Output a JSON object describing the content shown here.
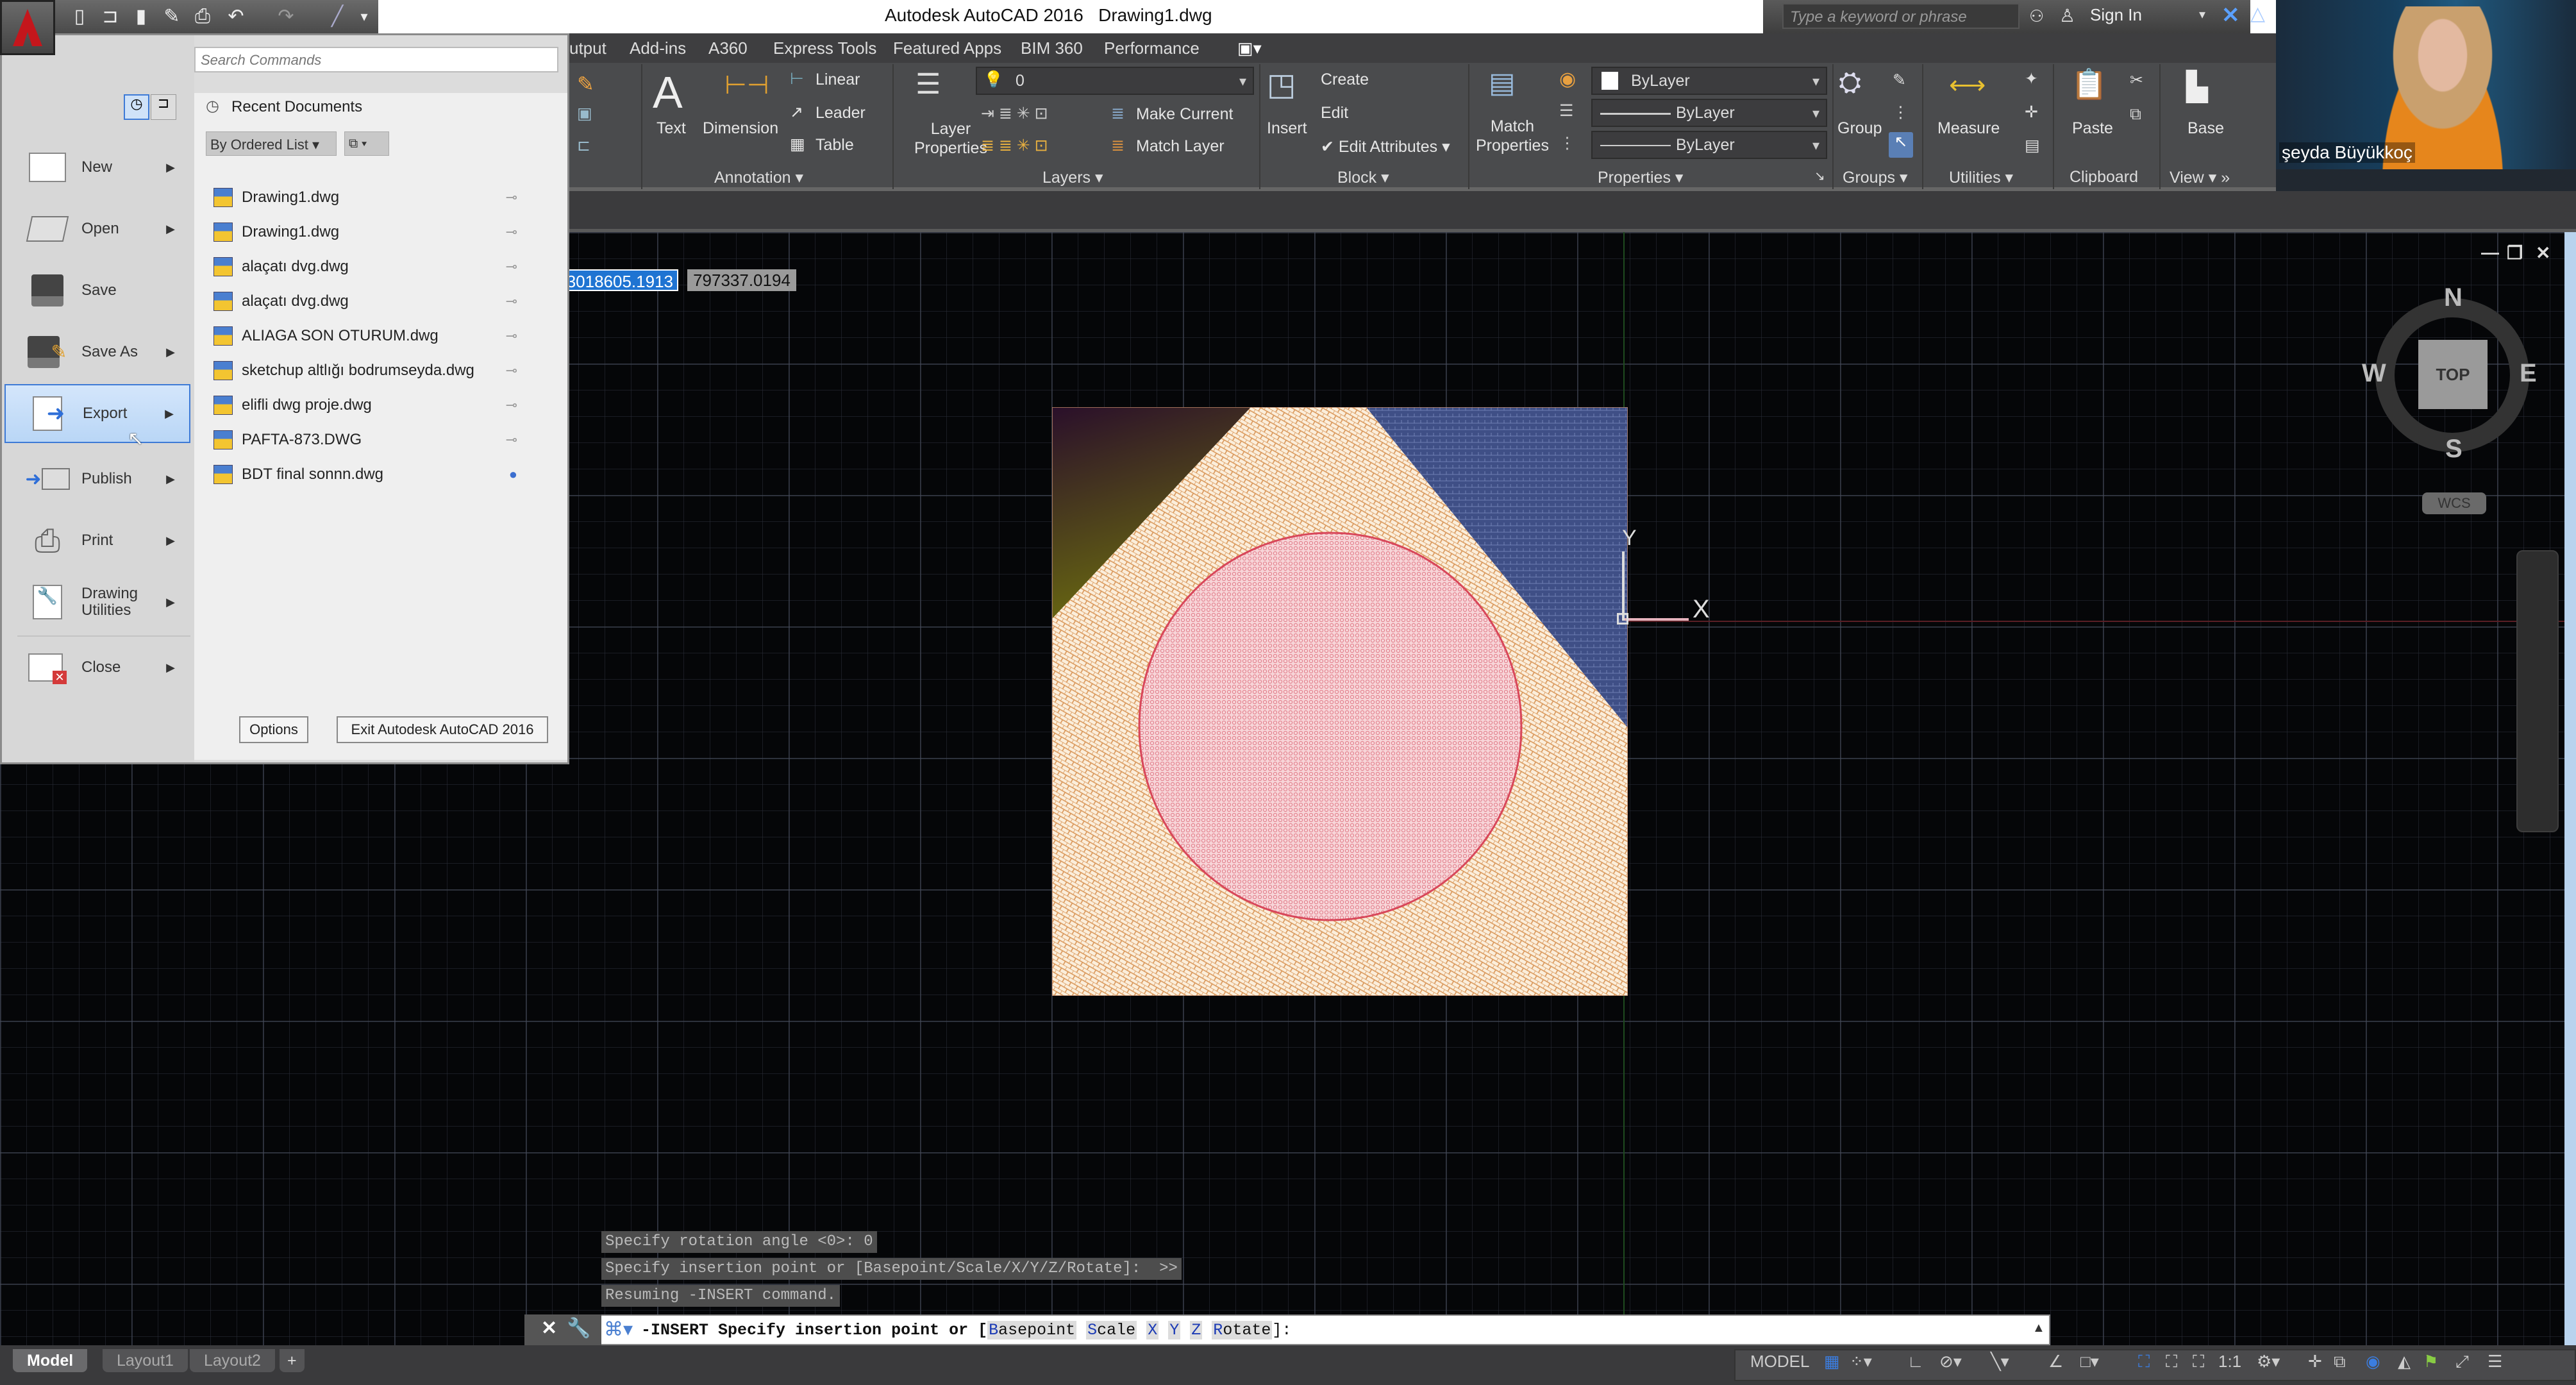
{
  "title_bar": {
    "app_title": "Autodesk AutoCAD 2016",
    "document": "Drawing1.dwg",
    "keyword_search_placeholder": "Type a keyword or phrase",
    "sign_in": "Sign In"
  },
  "quick_access": [
    "new-icon",
    "open-icon",
    "save-icon",
    "save-as-icon",
    "print-icon",
    "undo-icon",
    "redo-icon",
    "match-icon",
    "customize-icon"
  ],
  "ribbon_tabs": [
    "utput",
    "Add-ins",
    "A360",
    "Express Tools",
    "Featured Apps",
    "BIM 360",
    "Performance"
  ],
  "ribbon": {
    "annotation": {
      "title": "Annotation",
      "text": "Text",
      "dimension": "Dimension",
      "linear": "Linear",
      "leader": "Leader",
      "table": "Table"
    },
    "layers": {
      "title": "Layers",
      "layer_properties": [
        "Layer",
        "Properties"
      ],
      "current_layer": "0",
      "make_current": "Make Current",
      "match_layer": "Match Layer"
    },
    "block": {
      "title": "Block",
      "insert": "Insert",
      "create": "Create",
      "edit": "Edit",
      "edit_attributes": "Edit Attributes"
    },
    "properties": {
      "title": "Properties",
      "match_properties": [
        "Match",
        "Properties"
      ],
      "color": "ByLayer",
      "lineweight": "ByLayer",
      "linetype": "ByLayer"
    },
    "groups": {
      "title": "Groups",
      "group": "Group"
    },
    "utilities": {
      "title": "Utilities",
      "measure": "Measure"
    },
    "clipboard": {
      "title": "Clipboard",
      "paste": "Paste"
    },
    "view": {
      "title": "View",
      "base": "Base"
    }
  },
  "app_menu": {
    "search_placeholder": "Search Commands",
    "recent_header": "Recent Documents",
    "sort_option": "By Ordered List",
    "items": [
      {
        "label": "New",
        "has_submenu": true
      },
      {
        "label": "Open",
        "has_submenu": true
      },
      {
        "label": "Save",
        "has_submenu": false
      },
      {
        "label": "Save As",
        "has_submenu": true
      },
      {
        "label": "Export",
        "has_submenu": true,
        "active": true
      },
      {
        "label": "Publish",
        "has_submenu": true
      },
      {
        "label": "Print",
        "has_submenu": true
      },
      {
        "label": "Drawing Utilities",
        "has_submenu": true
      },
      {
        "label": "Close",
        "has_submenu": true
      }
    ],
    "recent_documents": [
      {
        "name": "Drawing1.dwg",
        "pinned": false
      },
      {
        "name": "Drawing1.dwg",
        "pinned": false
      },
      {
        "name": "alaçatı dvg.dwg",
        "pinned": false
      },
      {
        "name": "alaçatı dvg.dwg",
        "pinned": false
      },
      {
        "name": "ALIAGA SON OTURUM.dwg",
        "pinned": false
      },
      {
        "name": "sketchup altlığı bodrumseyda.dwg",
        "pinned": false
      },
      {
        "name": "elifli dwg proje.dwg",
        "pinned": false
      },
      {
        "name": "PAFTA-873.DWG",
        "pinned": false
      },
      {
        "name": "BDT final sonnn.dwg",
        "pinned": true
      }
    ],
    "options_button": "Options",
    "exit_button": "Exit Autodesk AutoCAD 2016"
  },
  "coordinates": {
    "x": "3018605.1913",
    "y": "797337.0194"
  },
  "viewcube": {
    "face": "TOP",
    "north": "N",
    "south": "S",
    "east": "E",
    "west": "W",
    "ucs": "WCS"
  },
  "ucs_icon": {
    "x_label": "X",
    "y_label": "Y"
  },
  "command_history": [
    "Specify rotation angle <0>: 0",
    "Specify insertion point or [Basepoint/Scale/X/Y/Z/Rotate]:  >>",
    "Resuming -INSERT command."
  ],
  "command_line": {
    "prefix": "-INSERT Specify insertion point or [",
    "options": [
      {
        "key": "B",
        "rest": "asepoint"
      },
      {
        "key": "S",
        "rest": "cale"
      },
      {
        "key": "X",
        "rest": ""
      },
      {
        "key": "Y",
        "rest": ""
      },
      {
        "key": "Z",
        "rest": ""
      },
      {
        "key": "R",
        "rest": "otate"
      }
    ],
    "suffix": "]:"
  },
  "layout_tabs": [
    {
      "label": "Model",
      "active": true
    },
    {
      "label": "Layout1",
      "active": false
    },
    {
      "label": "Layout2",
      "active": false
    },
    {
      "label": "+",
      "active": false
    }
  ],
  "status_bar": {
    "model": "MODEL",
    "scale": "1:1"
  },
  "webcam": {
    "name": "şeyda Büyükkoç"
  },
  "colors": {
    "accent": "#1f74d2",
    "hatch_beige": "#f5e6c8",
    "hatch_orange": "#d9905a",
    "circle_pink": "#e8a0aa",
    "circle_stroke": "#d8475a",
    "region_blue": "#3c4d82",
    "region_olive": "#5a5710"
  }
}
